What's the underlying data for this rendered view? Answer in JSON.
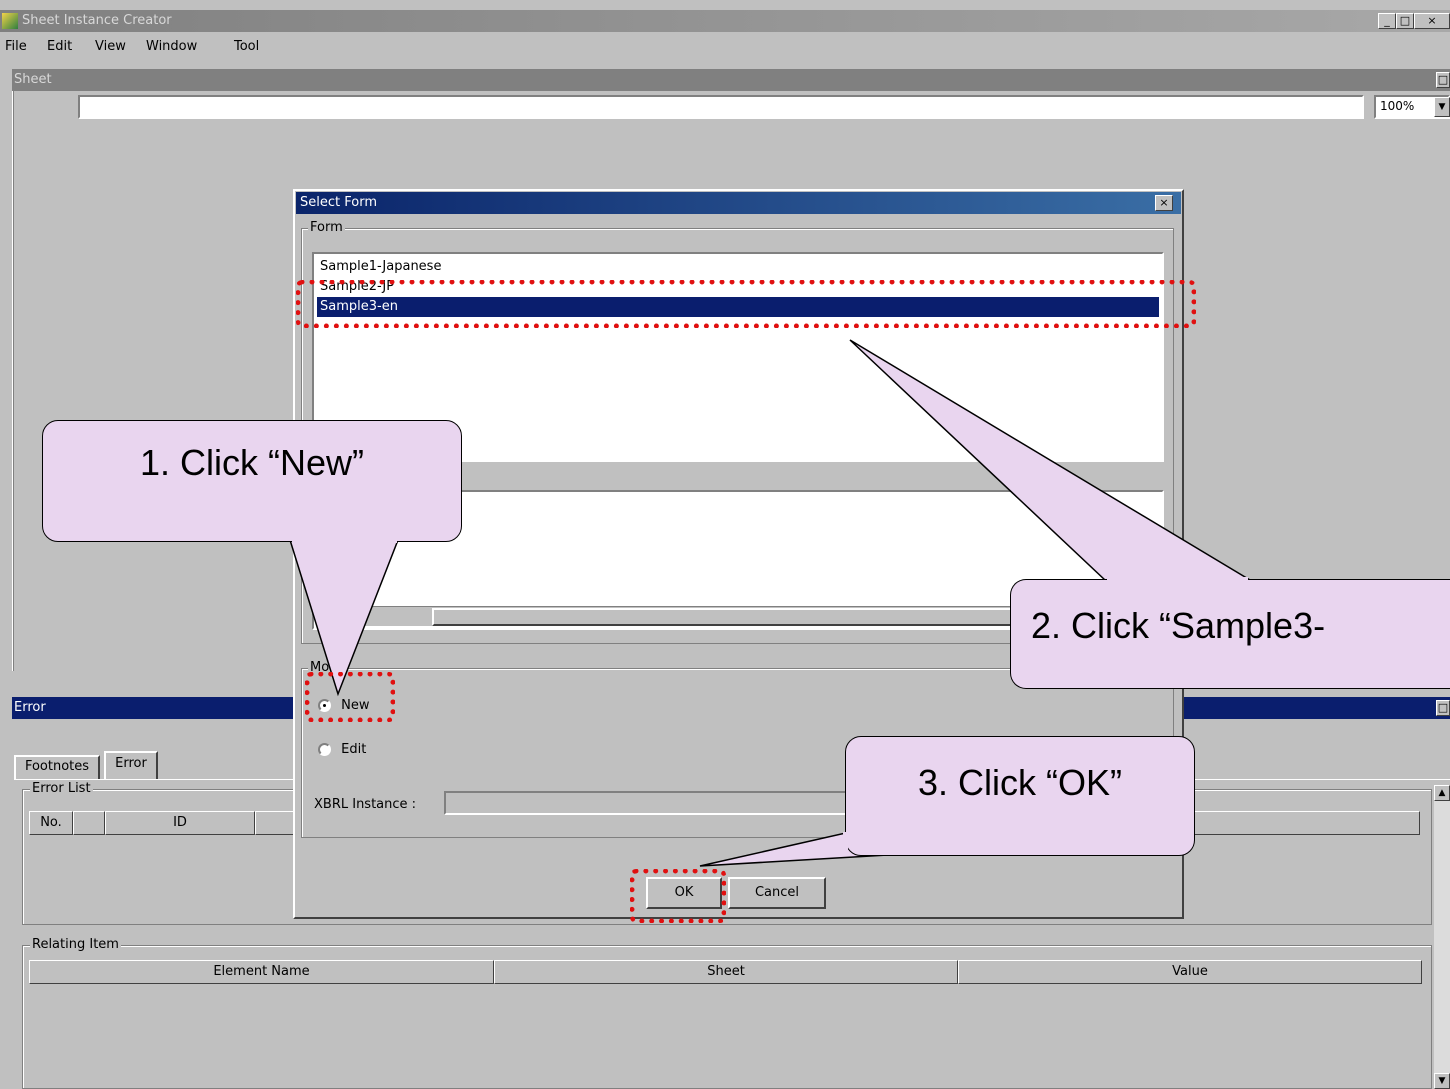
{
  "app": {
    "title": "Sheet Instance Creator"
  },
  "menu": [
    {
      "label": "File"
    },
    {
      "label": "Edit"
    },
    {
      "label": "View"
    },
    {
      "label": "Window"
    },
    {
      "label": "Tool"
    }
  ],
  "sheet": {
    "title": "Sheet",
    "zoom": "100%"
  },
  "dialog": {
    "title": "Select Form",
    "form_group": "Form",
    "forms": [
      "Sample1-Japanese",
      "Sample2-JP",
      "Sample3-en"
    ],
    "selected_form": "Sample3-en",
    "mode_group": "Mode",
    "mode_new": "New",
    "mode_edit": "Edit",
    "xbrl_label": "XBRL Instance :",
    "ok": "OK",
    "cancel": "Cancel"
  },
  "error_panel": {
    "title": "Error",
    "tabs": [
      "Footnotes",
      "Error"
    ],
    "error_list": "Error List",
    "error_columns": [
      "No.",
      "ID"
    ],
    "relating_item": "Relating Item",
    "relating_columns": [
      "Element Name",
      "Sheet",
      "Value"
    ]
  },
  "callouts": {
    "step1": "1. Click “New”",
    "step2": "2. Click “Sample3-",
    "step3": "3. Click “OK”"
  },
  "colors": {
    "selection": "#0a1e6e",
    "dialog_title": "#0a246a",
    "callout_fill": "#e9d5ef",
    "highlight": "#e01010"
  }
}
